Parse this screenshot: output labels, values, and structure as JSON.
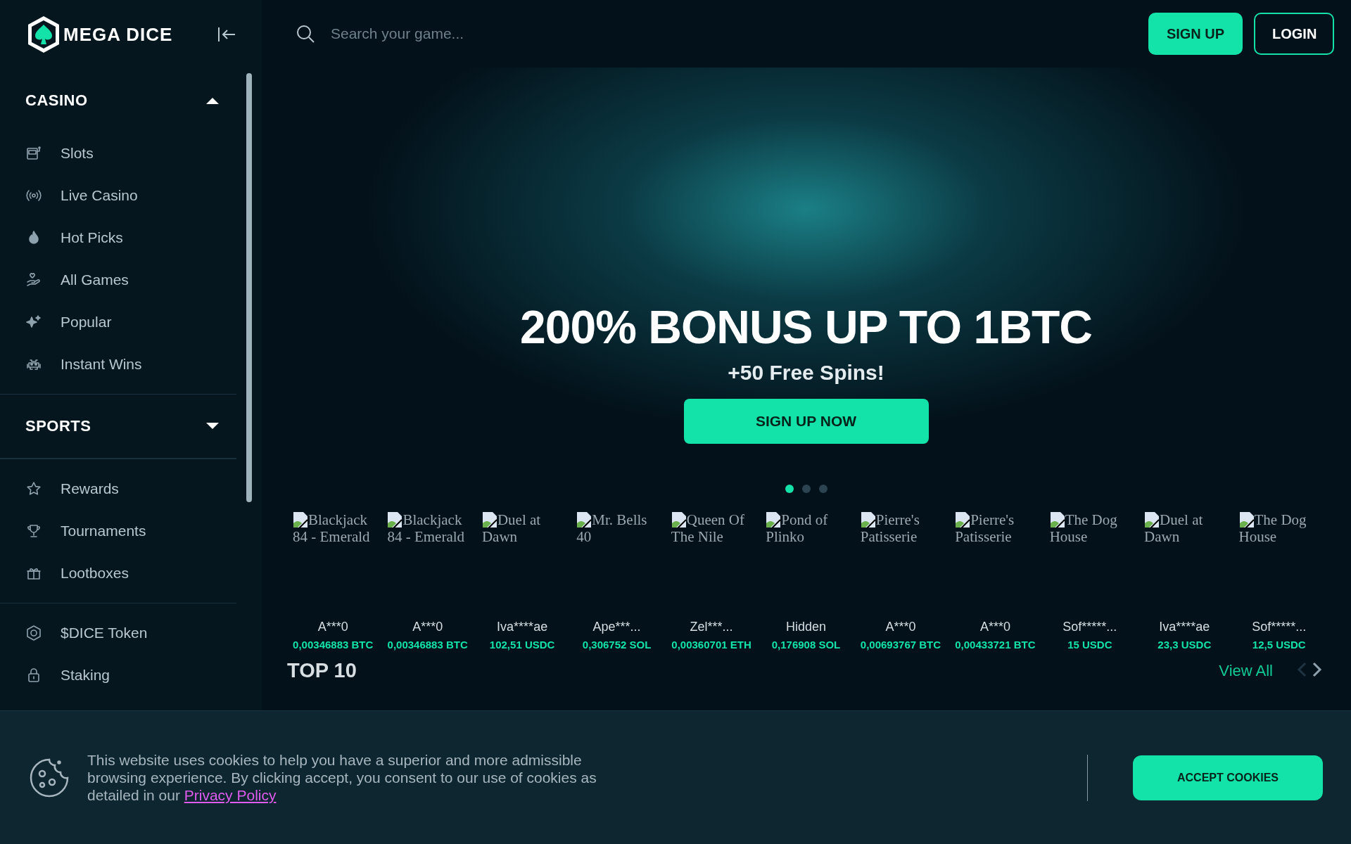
{
  "sidebar": {
    "logo": "MEGA DICE",
    "sections": [
      {
        "title": "CASINO",
        "expanded": true,
        "items": [
          {
            "label": "Slots"
          },
          {
            "label": "Live Casino"
          },
          {
            "label": "Hot Picks"
          },
          {
            "label": "All Games"
          },
          {
            "label": "Popular"
          },
          {
            "label": "Instant Wins"
          }
        ]
      },
      {
        "title": "SPORTS",
        "expanded": false
      }
    ],
    "groups": [
      [
        {
          "label": "Rewards"
        },
        {
          "label": "Tournaments"
        },
        {
          "label": "Lootboxes"
        }
      ],
      [
        {
          "label": "$DICE Token"
        },
        {
          "label": "Staking"
        }
      ]
    ]
  },
  "topbar": {
    "search": {
      "placeholder": "Search your game..."
    },
    "buttons": [
      "SIGN UP",
      "LOGIN"
    ]
  },
  "banner": {
    "headline": "200% BONUS UP TO 1BTC",
    "subline": "+50 Free Spins!",
    "button": "SIGN UP NOW",
    "dots": [
      {
        "selected": true
      },
      {
        "selected": false
      },
      {
        "selected": false
      }
    ]
  },
  "recent_wins": [
    {
      "game": "Blackjack 84 - Emerald",
      "user": "A***0",
      "amount": "0,00346883 BTC"
    },
    {
      "game": "Blackjack 84 - Emerald",
      "user": "A***0",
      "amount": "0,00346883 BTC"
    },
    {
      "game": "Duel at Dawn",
      "user": "Iva****ae",
      "amount": "102,51 USDC"
    },
    {
      "game": "Mr. Bells 40",
      "user": "Ape***...",
      "amount": "0,306752 SOL"
    },
    {
      "game": "Queen Of The Nile",
      "user": "Zel***...",
      "amount": "0,00360701 ETH"
    },
    {
      "game": "Pond of Plinko",
      "user": "Hidden",
      "amount": "0,176908 SOL"
    },
    {
      "game": "Pierre's Patisserie",
      "user": "A***0",
      "amount": "0,00693767 BTC"
    },
    {
      "game": "Pierre's Patisserie",
      "user": "A***0",
      "amount": "0,00433721 BTC"
    },
    {
      "game": "The Dog House",
      "user": "Sof*****...",
      "amount": "15 USDC"
    },
    {
      "game": "Duel at Dawn",
      "user": "Iva****ae",
      "amount": "23,3 USDC"
    },
    {
      "game": "The Dog House",
      "user": "Sof*****...",
      "amount": "12,5 USDC"
    }
  ],
  "top10": {
    "title": "TOP 10",
    "view_all": "View All",
    "prev_disabled": true
  },
  "cookie_bar": {
    "text": "This website uses cookies to help you have a superior and more admissible browsing experience. By clicking accept, you consent to our use of cookies as detailed in our ",
    "link": "Privacy Policy",
    "button": "ACCEPT COOKIES"
  }
}
